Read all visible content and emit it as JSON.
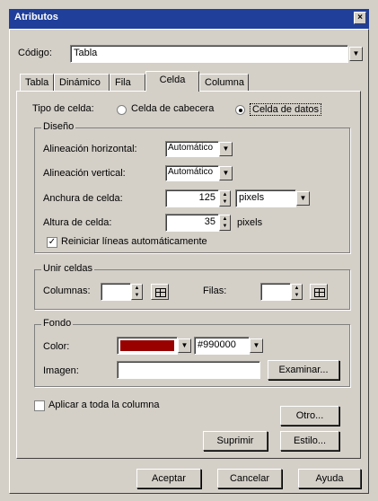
{
  "window": {
    "title": "Atributos",
    "close": "×"
  },
  "codigo": {
    "label": "Código:",
    "value": "Tabla"
  },
  "tabs": [
    "Tabla",
    "Dinámico",
    "Fila",
    "Celda",
    "Columna"
  ],
  "tipo_celda": {
    "label": "Tipo de celda:",
    "option1": "Celda de cabecera",
    "option2": "Celda de datos",
    "selected": "option2"
  },
  "diseno": {
    "legend": "Diseño",
    "align_h_label": "Alineación horizontal:",
    "align_h_value": "Automático",
    "align_v_label": "Alineación vertical:",
    "align_v_value": "Automático",
    "ancho_label": "Anchura de celda:",
    "ancho_value": "125",
    "ancho_unit": "pixels",
    "alto_label": "Altura de celda:",
    "alto_value": "35",
    "alto_unit": "pixels",
    "wrap_label": "Reiniciar líneas automáticamente",
    "wrap_checked": true
  },
  "unir": {
    "legend": "Unir celdas",
    "columnas_label": "Columnas:",
    "filas_label": "Filas:"
  },
  "fondo": {
    "legend": "Fondo",
    "color_label": "Color:",
    "color_swatch": "#990000",
    "color_value": "#990000",
    "imagen_label": "Imagen:",
    "examinar": "Examinar..."
  },
  "aplicar": {
    "label": "Aplicar a toda la columna",
    "checked": false
  },
  "buttons": {
    "otro": "Otro...",
    "suprimir": "Suprimir",
    "estilo": "Estilo...",
    "aceptar": "Aceptar",
    "cancelar": "Cancelar",
    "ayuda": "Ayuda"
  }
}
